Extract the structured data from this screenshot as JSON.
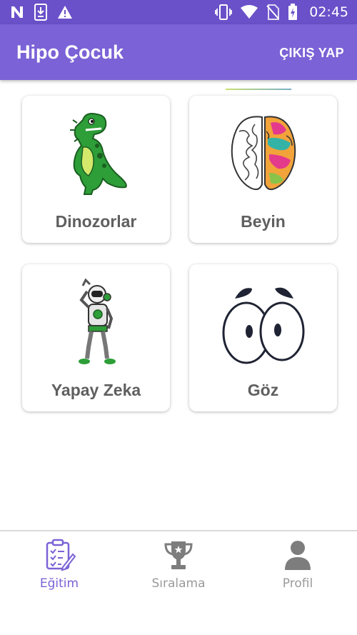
{
  "status_bar": {
    "time": "02:45",
    "icons": [
      "n-notification-icon",
      "download-icon",
      "warning-icon",
      "vibrate-icon",
      "wifi-icon",
      "no-sim-icon",
      "battery-charging-icon"
    ]
  },
  "app_bar": {
    "title": "Hipo Çocuk",
    "logout_label": "ÇIKIŞ YAP"
  },
  "categories": [
    {
      "label": "Dinozorlar",
      "icon": "dinosaur-illustration"
    },
    {
      "label": "Beyin",
      "icon": "brain-illustration"
    },
    {
      "label": "Yapay Zeka",
      "icon": "robot-illustration"
    },
    {
      "label": "Göz",
      "icon": "eyes-illustration"
    }
  ],
  "bottom_nav": {
    "items": [
      {
        "label": "Eğitim",
        "icon": "clipboard-icon",
        "active": true
      },
      {
        "label": "Sıralama",
        "icon": "trophy-icon",
        "active": false
      },
      {
        "label": "Profil",
        "icon": "person-icon",
        "active": false
      }
    ]
  },
  "colors": {
    "status_bar": "#6a51c9",
    "app_bar": "#7b62d6",
    "active_nav": "#7b62d6",
    "inactive_nav": "#9a9a9a",
    "card_label": "#5f5f5f"
  }
}
